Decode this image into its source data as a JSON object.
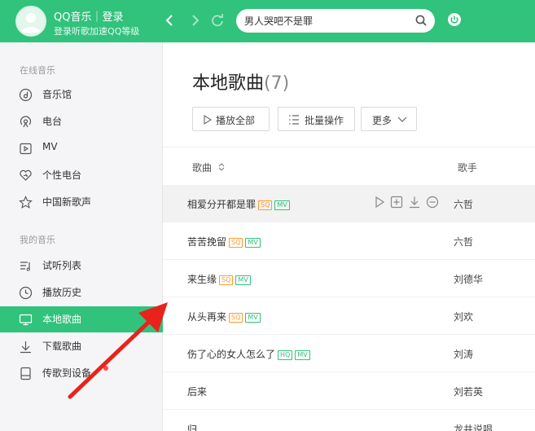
{
  "topbar": {
    "brand": "QQ音乐｜登录",
    "subtitle": "登录听歌加速QQ等级",
    "back_icon": "chevron-left-icon",
    "forward_icon": "chevron-right-icon",
    "refresh_icon": "refresh-icon",
    "search_value": "男人哭吧不是罪",
    "search_icon": "search-icon",
    "power_icon": "power-icon"
  },
  "sidebar": {
    "online_title": "在线音乐",
    "online_items": [
      {
        "label": "音乐馆",
        "icon": "music-hall-icon"
      },
      {
        "label": "电台",
        "icon": "radio-icon"
      },
      {
        "label": "MV",
        "icon": "mv-icon"
      },
      {
        "label": "个性电台",
        "icon": "heart-icon"
      },
      {
        "label": "中国新歌声",
        "icon": "star-icon"
      }
    ],
    "my_title": "我的音乐",
    "my_items": [
      {
        "label": "试听列表",
        "icon": "playlist-icon"
      },
      {
        "label": "播放历史",
        "icon": "clock-icon"
      },
      {
        "label": "本地歌曲",
        "icon": "monitor-icon",
        "active": true
      },
      {
        "label": "下载歌曲",
        "icon": "download-icon"
      },
      {
        "label": "传歌到设备",
        "icon": "device-icon"
      }
    ]
  },
  "main": {
    "title": "本地歌曲",
    "count": "(7)",
    "buttons": {
      "play_all": "播放全部",
      "batch": "批量操作",
      "more": "更多"
    },
    "headers": {
      "song": "歌曲",
      "singer": "歌手"
    },
    "songs": [
      {
        "title": "相爱分开都是罪",
        "tags": [
          "SQ",
          "MV"
        ],
        "singer": "六哲"
      },
      {
        "title": "苦苦挽留",
        "tags": [
          "SQ",
          "MV"
        ],
        "singer": "六哲"
      },
      {
        "title": "来生缘",
        "tags": [
          "SQ",
          "MV"
        ],
        "singer": "刘德华"
      },
      {
        "title": "从头再来",
        "tags": [
          "SQ",
          "MV"
        ],
        "singer": "刘欢"
      },
      {
        "title": "伤了心的女人怎么了",
        "tags": [
          "HQ",
          "MV"
        ],
        "singer": "刘涛"
      },
      {
        "title": "后来",
        "tags": [],
        "singer": "刘若英"
      },
      {
        "title": "归",
        "tags": [],
        "singer": "龙井说唱"
      }
    ]
  },
  "colors": {
    "accent": "#31c27c",
    "sq": "#ff9a2e",
    "annotation": "#e8231b"
  }
}
